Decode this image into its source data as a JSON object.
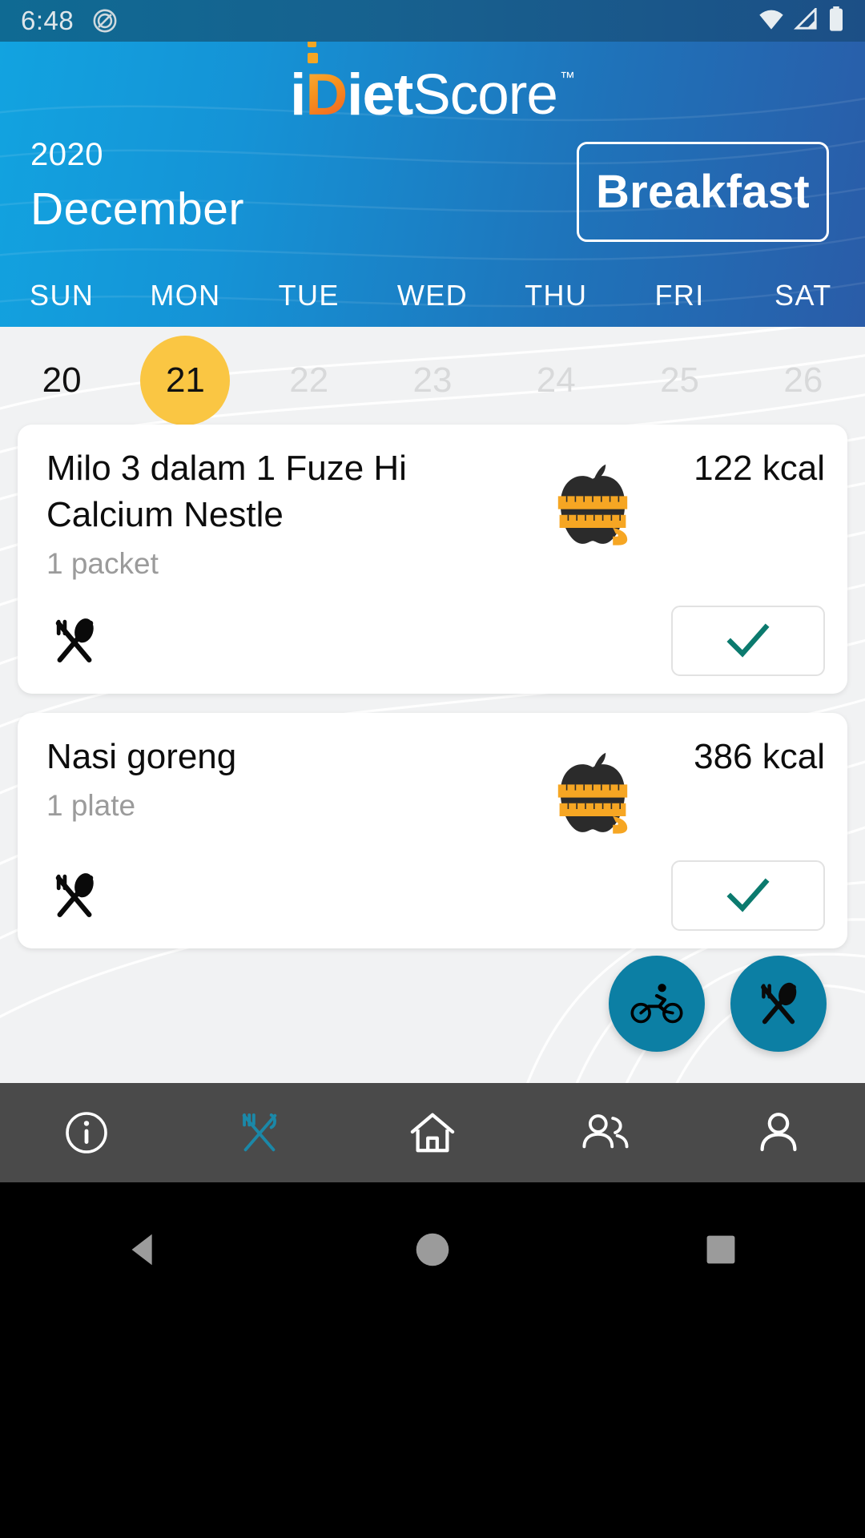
{
  "status_bar": {
    "time": "6:48",
    "icons": [
      "dnd-icon",
      "wifi-icon",
      "signal-icon",
      "battery-icon"
    ]
  },
  "header": {
    "logo": {
      "part_i": "i",
      "part_d": "D",
      "part_iet": "iet",
      "part_score": "Score",
      "trademark": "™"
    },
    "year": "2020",
    "month": "December",
    "meal_button": "Breakfast",
    "weekdays": [
      "SUN",
      "MON",
      "TUE",
      "WED",
      "THU",
      "FRI",
      "SAT"
    ],
    "colors": {
      "gradient_start": "#12a3e0",
      "gradient_end": "#2a5ca8"
    }
  },
  "calendar": {
    "days": [
      {
        "num": "20",
        "state": "past"
      },
      {
        "num": "21",
        "state": "selected"
      },
      {
        "num": "22",
        "state": "future"
      },
      {
        "num": "23",
        "state": "future"
      },
      {
        "num": "24",
        "state": "future"
      },
      {
        "num": "25",
        "state": "future"
      },
      {
        "num": "26",
        "state": "future"
      }
    ],
    "selected_color": "#fac643"
  },
  "meals": [
    {
      "name": "Milo 3 dalam 1 Fuze Hi Calcium Nestle",
      "quantity": "1 packet",
      "calories": "122 kcal",
      "food_icon": "apple-measuring-tape-icon",
      "cutlery_icon": "fork-spoon-icon",
      "action_icon": "check-icon"
    },
    {
      "name": "Nasi goreng",
      "quantity": "1 plate",
      "calories": "386 kcal",
      "food_icon": "apple-measuring-tape-icon",
      "cutlery_icon": "fork-spoon-icon",
      "action_icon": "check-icon"
    }
  ],
  "fabs": [
    {
      "name": "add-exercise-fab",
      "icon": "cycling-icon"
    },
    {
      "name": "add-meal-fab",
      "icon": "fork-spoon-icon"
    }
  ],
  "bottom_nav": {
    "items": [
      {
        "name": "info",
        "icon": "info-circle-icon",
        "active": false
      },
      {
        "name": "diet",
        "icon": "fork-knife-icon",
        "active": true
      },
      {
        "name": "home",
        "icon": "home-icon",
        "active": false
      },
      {
        "name": "community",
        "icon": "people-icon",
        "active": false
      },
      {
        "name": "profile",
        "icon": "person-icon",
        "active": false
      }
    ],
    "background": "#4a4a4a",
    "active_color": "#1b88a8",
    "inactive_color": "#ffffff"
  },
  "android_nav": {
    "buttons": [
      {
        "name": "back",
        "icon": "triangle-back-icon"
      },
      {
        "name": "home",
        "icon": "circle-home-icon"
      },
      {
        "name": "recents",
        "icon": "square-recents-icon"
      }
    ]
  }
}
